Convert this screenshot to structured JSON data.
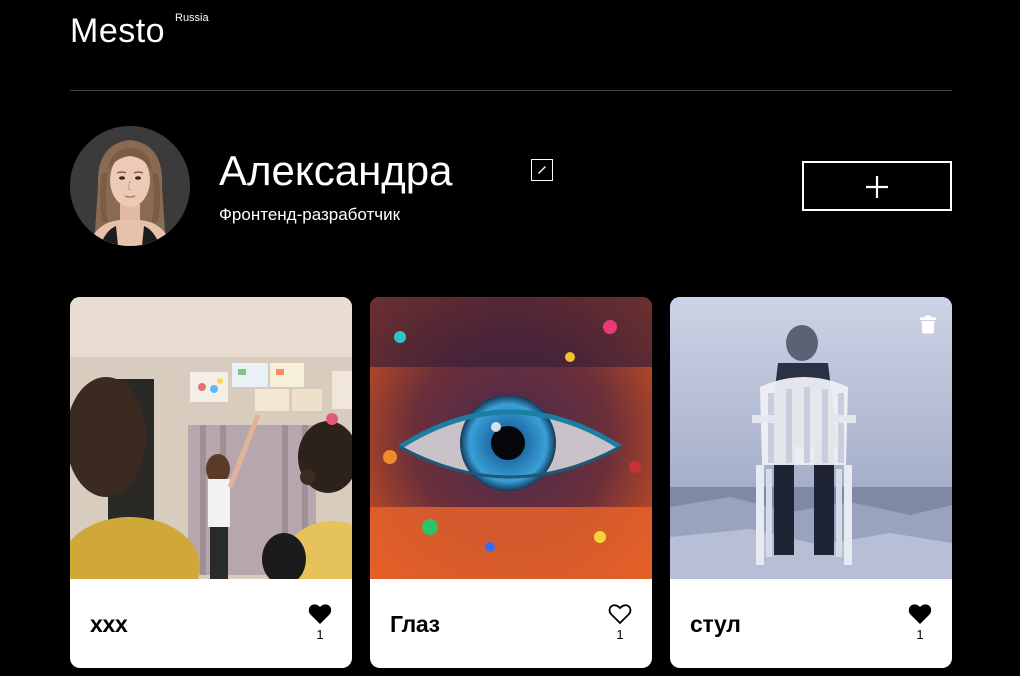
{
  "header": {
    "logo": "Mesto",
    "logo_superscript": "Russia"
  },
  "profile": {
    "name": "Александра",
    "about": "Фронтенд-разработчик"
  },
  "icons": {
    "edit": "pencil-icon",
    "add": "plus-icon",
    "like": "heart-icon",
    "delete": "trash-icon"
  },
  "cards": [
    {
      "title": "xxx",
      "likes": "1",
      "liked": true,
      "deletable": false
    },
    {
      "title": "Глаз",
      "likes": "1",
      "liked": false,
      "deletable": false
    },
    {
      "title": "стул",
      "likes": "1",
      "liked": true,
      "deletable": true
    }
  ]
}
